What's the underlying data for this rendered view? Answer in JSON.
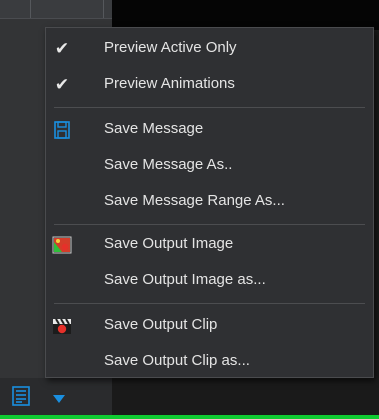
{
  "menu": {
    "items": [
      {
        "label": "Preview Active Only",
        "checked": true,
        "icon": "check-icon"
      },
      {
        "label": "Preview Animations",
        "checked": true,
        "icon": "check-icon"
      },
      {
        "label": "Save Message",
        "icon": "floppy-disk-icon"
      },
      {
        "label": "Save Message As.."
      },
      {
        "label": "Save Message Range As..."
      },
      {
        "label": "Save Output Image",
        "icon": "image-icon"
      },
      {
        "label": "Save Output Image as..."
      },
      {
        "label": "Save Output Clip",
        "icon": "clapperboard-icon"
      },
      {
        "label": "Save Output Clip as..."
      }
    ],
    "check_glyph": "✔"
  },
  "toolbar": {
    "icon": "document-list-icon",
    "dropdown_icon": "triangle-down-icon"
  },
  "colors": {
    "menu_bg": "#2f3033",
    "menu_text": "#e4e4e4",
    "accent_blue": "#1a8fe0",
    "status_green": "#0fcc32"
  }
}
